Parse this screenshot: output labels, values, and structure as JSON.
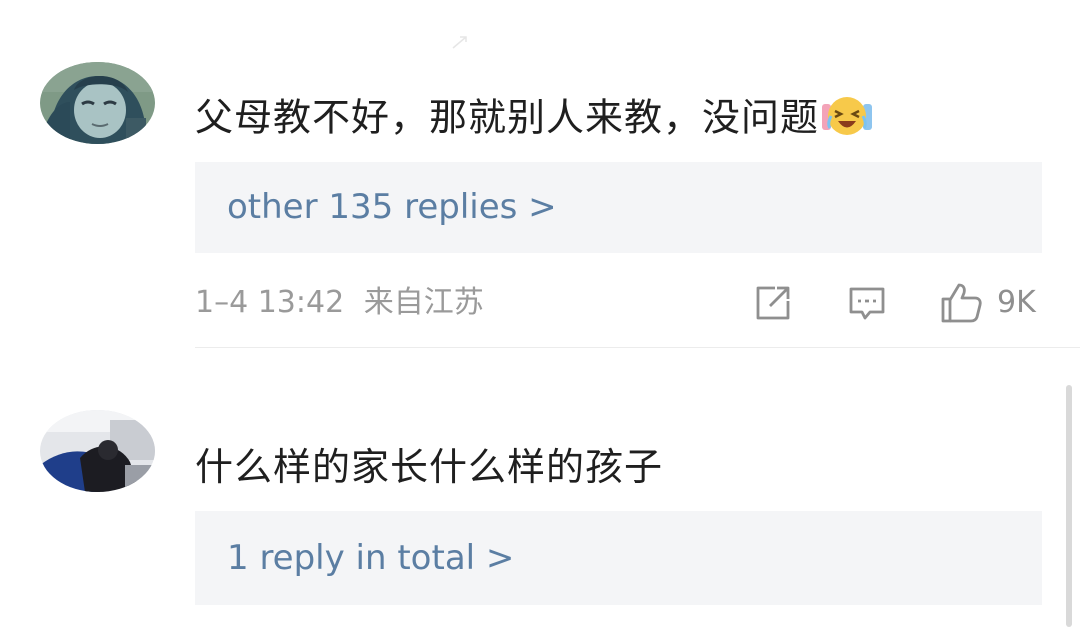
{
  "comments": [
    {
      "avatar_icon": "corpse-bride-character-avatar",
      "text": "父母教不好，那就别人来教，没问题",
      "emoji_icon": "laugh-crying-emoji-icon",
      "replies_label": "other 135 replies >",
      "meta": {
        "time": "1–4 13:42",
        "location": "来自江苏",
        "like_count": "9K"
      },
      "actions": [
        "share-icon",
        "comment-icon",
        "like-icon"
      ]
    },
    {
      "avatar_icon": "car-seat-photo-avatar",
      "text": "什么样的家长什么样的孩子",
      "replies_label": "1 reply in total >"
    }
  ],
  "colors": {
    "text": "#1f1f1f",
    "link": "#5b7ea3",
    "meta": "#9a9a9a",
    "reply_bg": "#f4f5f7"
  }
}
